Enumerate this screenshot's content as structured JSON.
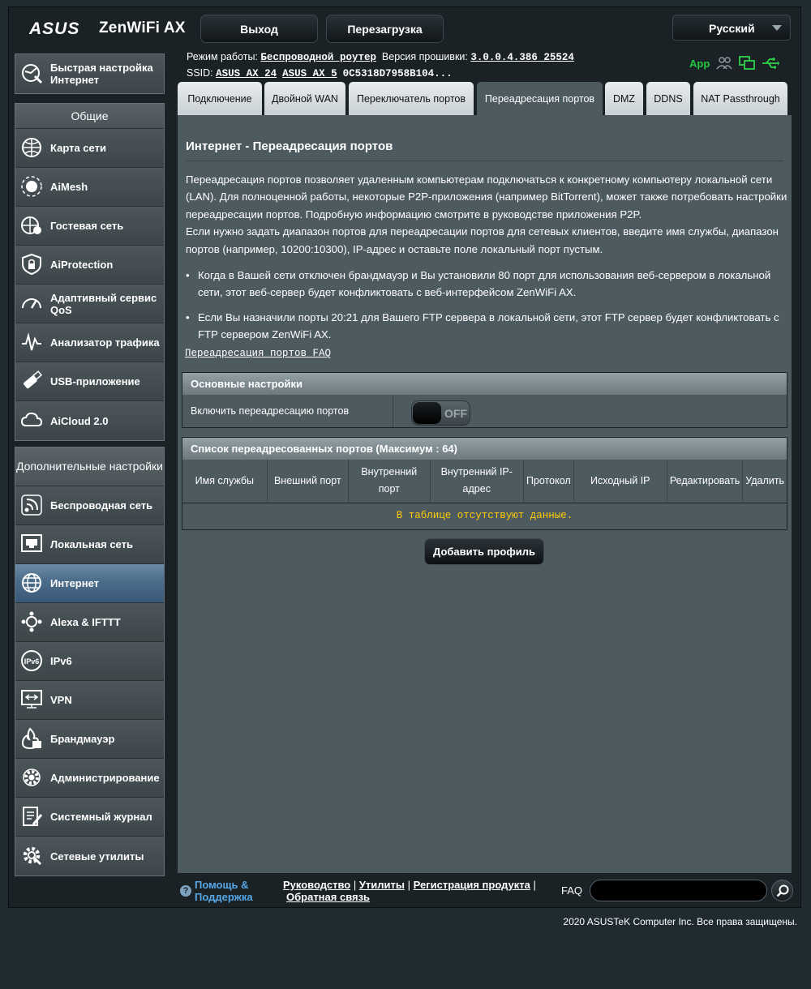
{
  "header": {
    "brand": "ASUS",
    "model": "ZenWiFi AX",
    "logout_label": "Выход",
    "reboot_label": "Перезагрузка",
    "language": "Русский",
    "op_mode_label": "Режим работы:",
    "op_mode_value": "Беспроводной роутер",
    "firmware_label": "Версия прошивки:",
    "firmware_value": "3.0.0.4.386_25524",
    "ssid_label": "SSID:",
    "ssid_1": "ASUS_AX_24",
    "ssid_2": "ASUS_AX_5",
    "mac": "0C5318D7958B104...",
    "app_label": "App"
  },
  "sidebar": {
    "quick_setup": "Быстрая настройка Интернет",
    "general_title": "Общие",
    "general": [
      {
        "label": "Карта сети",
        "icon": "network-map-icon"
      },
      {
        "label": "AiMesh",
        "icon": "aimesh-icon"
      },
      {
        "label": "Гостевая сеть",
        "icon": "guest-network-icon"
      },
      {
        "label": "AiProtection",
        "icon": "shield-lock-icon"
      },
      {
        "label": "Адаптивный сервис QoS",
        "icon": "speedometer-icon"
      },
      {
        "label": "Анализатор трафика",
        "icon": "traffic-analyzer-icon"
      },
      {
        "label": "USB-приложение",
        "icon": "usb-icon"
      },
      {
        "label": "AiCloud 2.0",
        "icon": "cloud-icon"
      }
    ],
    "advanced_title": "Дополнительные настройки",
    "advanced": [
      {
        "label": "Беспроводная сеть",
        "icon": "wireless-icon"
      },
      {
        "label": "Локальная сеть",
        "icon": "lan-icon"
      },
      {
        "label": "Интернет",
        "icon": "globe-icon"
      },
      {
        "label": "Alexa & IFTTT",
        "icon": "alexa-icon"
      },
      {
        "label": "IPv6",
        "icon": "ipv6-icon"
      },
      {
        "label": "VPN",
        "icon": "vpn-icon"
      },
      {
        "label": "Брандмауэр",
        "icon": "firewall-icon"
      },
      {
        "label": "Администрирование",
        "icon": "admin-gear-icon"
      },
      {
        "label": "Системный журнал",
        "icon": "system-log-icon"
      },
      {
        "label": "Сетевые утилиты",
        "icon": "network-tools-icon"
      }
    ],
    "active": "Интернет"
  },
  "tabs": [
    {
      "label": "Подключение"
    },
    {
      "label": "Двойной WAN"
    },
    {
      "label": "Переключатель портов"
    },
    {
      "label": "Переадресация портов"
    },
    {
      "label": "DMZ"
    },
    {
      "label": "DDNS"
    },
    {
      "label": "NAT Passthrough"
    }
  ],
  "active_tab": "Переадресация портов",
  "page": {
    "title": "Интернет - Переадресация портов",
    "desc_1": "Переадресация портов позволяет удаленным компьютерам подключаться к конкретному компьютеру локальной сети (LAN). Для полноценной работы, некоторые P2P-приложения (например BitTorrent), может также потребовать настройки переадресации портов. Подробную информацию смотрите в руководстве приложения P2P.",
    "desc_2": "Если нужно задать диапазон портов для переадресации портов для сетевых клиентов, введите имя службы, диапазон портов (например, 10200:10300), IP-адрес и оставьте поле локальный порт пустым.",
    "bullet_1": "Когда в Вашей сети отключен брандмауэр и Вы установили 80 порт для использования веб-сервером в локальной сети, этот веб-сервер будет конфликтовать с веб-интерфейсом ZenWiFi AX.",
    "bullet_2": "Если Вы назначили порты 20:21 для Вашего FTP сервера в локальной сети, этот FTP сервер будет конфликтовать с FTP сервером ZenWiFi AX.",
    "faq_link": "Переадресация портов FAQ",
    "basic_title": "Основные настройки",
    "enable_label": "Включить переадресацию портов",
    "enable_state": "OFF",
    "list_title": "Список переадресованных портов (Максимум : 64)",
    "columns": [
      "Имя службы",
      "Внешний порт",
      "Внутренний порт",
      "Внутренний IP-адрес",
      "Протокол",
      "Исходный IP",
      "Редактировать",
      "Удалить"
    ],
    "empty_text": "В таблице отсутствуют данные.",
    "add_button": "Добавить профиль"
  },
  "footer": {
    "help": "Помощь & Поддержка",
    "link_manual": "Руководство",
    "link_utils": "Утилиты",
    "link_register": "Регистрация продукта",
    "link_feedback": "Обратная связь",
    "faq_label": "FAQ",
    "copyright": "2020 ASUSTeK Computer Inc. Все права защищены."
  }
}
